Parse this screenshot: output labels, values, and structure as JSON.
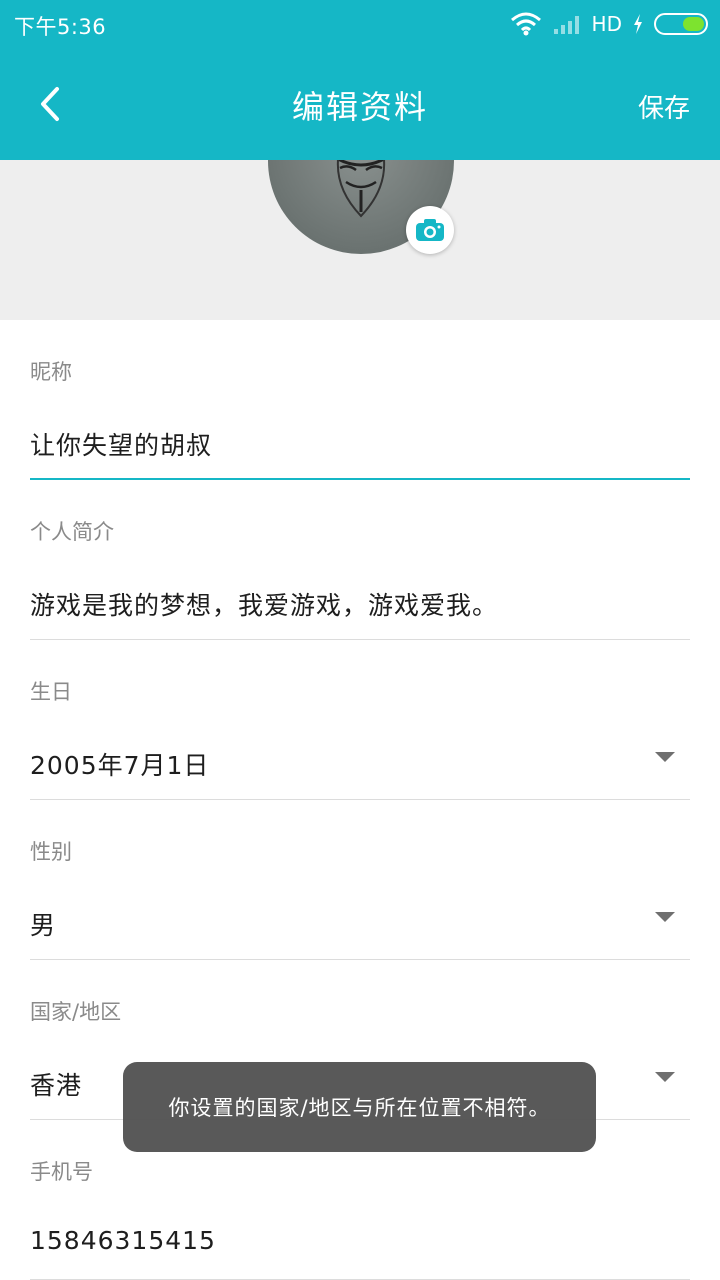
{
  "status_bar": {
    "time": "下午5:36",
    "network_label": "HD",
    "battery_level": 0.45,
    "icons": [
      "wifi-icon",
      "signal-icon",
      "charging-icon",
      "battery-icon"
    ]
  },
  "app_bar": {
    "title": "编辑资料",
    "save_label": "保存",
    "back_icon": "chevron-left-icon",
    "background_color": "#15b7c6"
  },
  "profile": {
    "avatar_icon": "mask-avatar",
    "camera_icon": "camera-icon"
  },
  "fields": [
    {
      "label": "昵称",
      "value": "让你失望的胡叔"
    },
    {
      "label": "个人简介",
      "value": "游戏是我的梦想，我爱游戏，游戏爱我。"
    },
    {
      "label": "生日",
      "value": "2005年7月1日"
    },
    {
      "label": "性别",
      "value": "男"
    },
    {
      "label": "国家/地区",
      "value": "香港"
    },
    {
      "label": "手机号",
      "value": "15846315415"
    }
  ],
  "toast": {
    "message": "你设置的国家/地区与所在位置不相符。"
  }
}
